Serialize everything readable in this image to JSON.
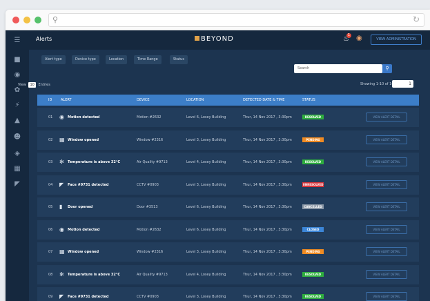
{
  "app": {
    "page_title": "Alerts",
    "brand": "BEYOND",
    "notification_count": "1",
    "admin_button": "VIEW ADMINISTRATION"
  },
  "filters": [
    {
      "label": "Alert type"
    },
    {
      "label": "Device type"
    },
    {
      "label": "Location"
    },
    {
      "label": "Time Range"
    },
    {
      "label": "Status"
    }
  ],
  "search": {
    "placeholder": "Search"
  },
  "pagination": {
    "view_label": "View",
    "entries_selected": "10",
    "entries_label": "Entries",
    "showing": "Showing 1-10 of 100",
    "page": "1"
  },
  "table": {
    "columns": [
      "ID",
      "ALERT",
      "DEVICE",
      "LOCATION",
      "DETECTED DATE & TIME",
      "STATUS"
    ],
    "rows": [
      {
        "id": "01",
        "alert": "Motion detected",
        "device": "Motion #2632",
        "location": "Level 6, Losey Building",
        "time": "Thur, 14 Nov 2017 , 3:30pm",
        "status": "RESOLVED",
        "status_color": "#2fae3f",
        "icon": "motion-icon",
        "icon_glyph": "◉",
        "action": "VIEW ALERT DETAIL"
      },
      {
        "id": "02",
        "alert": "Window opened",
        "device": "Window #2316",
        "location": "Level 3, Losey Building",
        "time": "Thur, 14 Nov 2017 , 3:30pm",
        "status": "PENDING",
        "status_color": "#f08b22",
        "icon": "window-icon",
        "icon_glyph": "▦",
        "action": "VIEW ALERT DETAIL"
      },
      {
        "id": "03",
        "alert": "Temperature is above 32°C",
        "device": "Air Quality #9713",
        "location": "Level 4, Losey Building",
        "time": "Thur, 14 Nov 2017 , 3:30pm",
        "status": "RESOLVED",
        "status_color": "#2fae3f",
        "icon": "temperature-icon",
        "icon_glyph": "✻",
        "action": "VIEW ALERT DETAIL"
      },
      {
        "id": "04",
        "alert": "Face #9731 detected",
        "device": "CCTV #0903",
        "location": "Level 3, Losey Building",
        "time": "Thur, 14 Nov 2017 , 3:30pm",
        "status": "UNRESOLVED",
        "status_color": "#d9343a",
        "icon": "camera-icon",
        "icon_glyph": "◤",
        "action": "VIEW ALERT DETAIL"
      },
      {
        "id": "05",
        "alert": "Door opened",
        "device": "Door #3513",
        "location": "Level 6, Losey Building",
        "time": "Thur, 14 Nov 2017 , 3:30pm",
        "status": "CANCELLED",
        "status_color": "#8a97a6",
        "icon": "door-icon",
        "icon_glyph": "▮",
        "action": "VIEW ALERT DETAIL"
      },
      {
        "id": "06",
        "alert": "Motion detected",
        "device": "Motion #2632",
        "location": "Level 6, Losey Building",
        "time": "Thur, 14 Nov 2017 , 3:30pm",
        "status": "CLOSED",
        "status_color": "#3c86d8",
        "icon": "motion-icon",
        "icon_glyph": "◉",
        "action": "VIEW ALERT DETAIL"
      },
      {
        "id": "07",
        "alert": "Window opened",
        "device": "Window #2316",
        "location": "Level 3, Losey Building",
        "time": "Thur, 14 Nov 2017 , 3:30pm",
        "status": "PENDING",
        "status_color": "#f08b22",
        "icon": "window-icon",
        "icon_glyph": "▦",
        "action": "VIEW ALERT DETAIL"
      },
      {
        "id": "08",
        "alert": "Temperature is above 32°C",
        "device": "Air Quality #9713",
        "location": "Level 4, Losey Building",
        "time": "Thur, 14 Nov 2017 , 3:30pm",
        "status": "RESOLVED",
        "status_color": "#2fae3f",
        "icon": "temperature-icon",
        "icon_glyph": "✻",
        "action": "VIEW ALERT DETAIL"
      },
      {
        "id": "09",
        "alert": "Face #9731 detected",
        "device": "CCTV #0903",
        "location": "Level 3, Losey Building",
        "time": "Thur, 14 Nov 2017 , 3:30pm",
        "status": "RESOLVED",
        "status_color": "#2fae3f",
        "icon": "camera-icon",
        "icon_glyph": "◤",
        "action": "VIEW ALERT DETAIL"
      }
    ]
  },
  "colors": {
    "sidebar": "#15283e",
    "background": "#1c3450",
    "row": "#223d5c",
    "header": "#3c7ec8",
    "accent": "#3a78c8"
  }
}
